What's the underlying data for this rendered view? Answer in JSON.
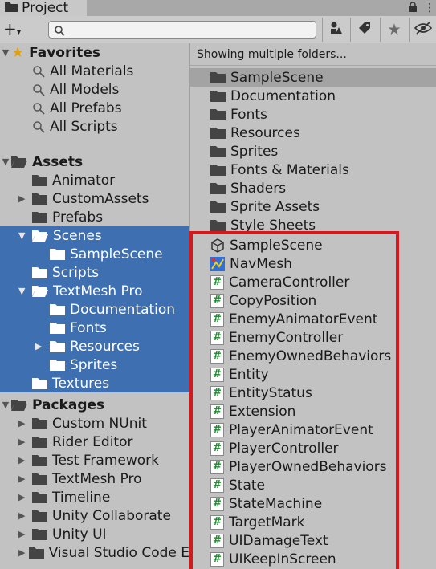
{
  "window": {
    "tab_title": "Project"
  },
  "toolbar": {
    "add_label": "+",
    "search_placeholder": ""
  },
  "tree": {
    "favorites": {
      "label": "Favorites",
      "items": [
        "All Materials",
        "All Models",
        "All Prefabs",
        "All Scripts"
      ]
    },
    "assets": {
      "label": "Assets"
    },
    "animator": "Animator",
    "customassets": "CustomAssets",
    "prefabs": "Prefabs",
    "scenes": "Scenes",
    "samplescene": "SampleScene",
    "scripts": "Scripts",
    "textmeshpro": "TextMesh Pro",
    "documentation": "Documentation",
    "fonts": "Fonts",
    "resources": "Resources",
    "sprites": "Sprites",
    "textures": "Textures",
    "packages": {
      "label": "Packages",
      "items": [
        "Custom NUnit",
        "Rider Editor",
        "Test Framework",
        "TextMesh Pro",
        "Timeline",
        "Unity Collaborate",
        "Unity UI",
        "Visual Studio Code E"
      ]
    }
  },
  "content": {
    "status": "Showing multiple folders...",
    "folders": [
      "SampleScene",
      "Documentation",
      "Fonts",
      "Resources",
      "Sprites",
      "Fonts & Materials",
      "Shaders",
      "Sprite Assets",
      "Style Sheets"
    ],
    "scene": "SampleScene",
    "navmesh": "NavMesh",
    "scripts": [
      "CameraController",
      "CopyPosition",
      "EnemyAnimatorEvent",
      "EnemyController",
      "EnemyOwnedBehaviors",
      "Entity",
      "EntityStatus",
      "Extension",
      "PlayerAnimatorEvent",
      "PlayerController",
      "PlayerOwnedBehaviors",
      "State",
      "StateMachine",
      "TargetMark",
      "UIDamageText",
      "UIKeepInScreen"
    ]
  },
  "colors": {
    "selection": "#3e6fb0",
    "highlight_box": "#d4191e",
    "script_hash": "#1a8a2a"
  }
}
